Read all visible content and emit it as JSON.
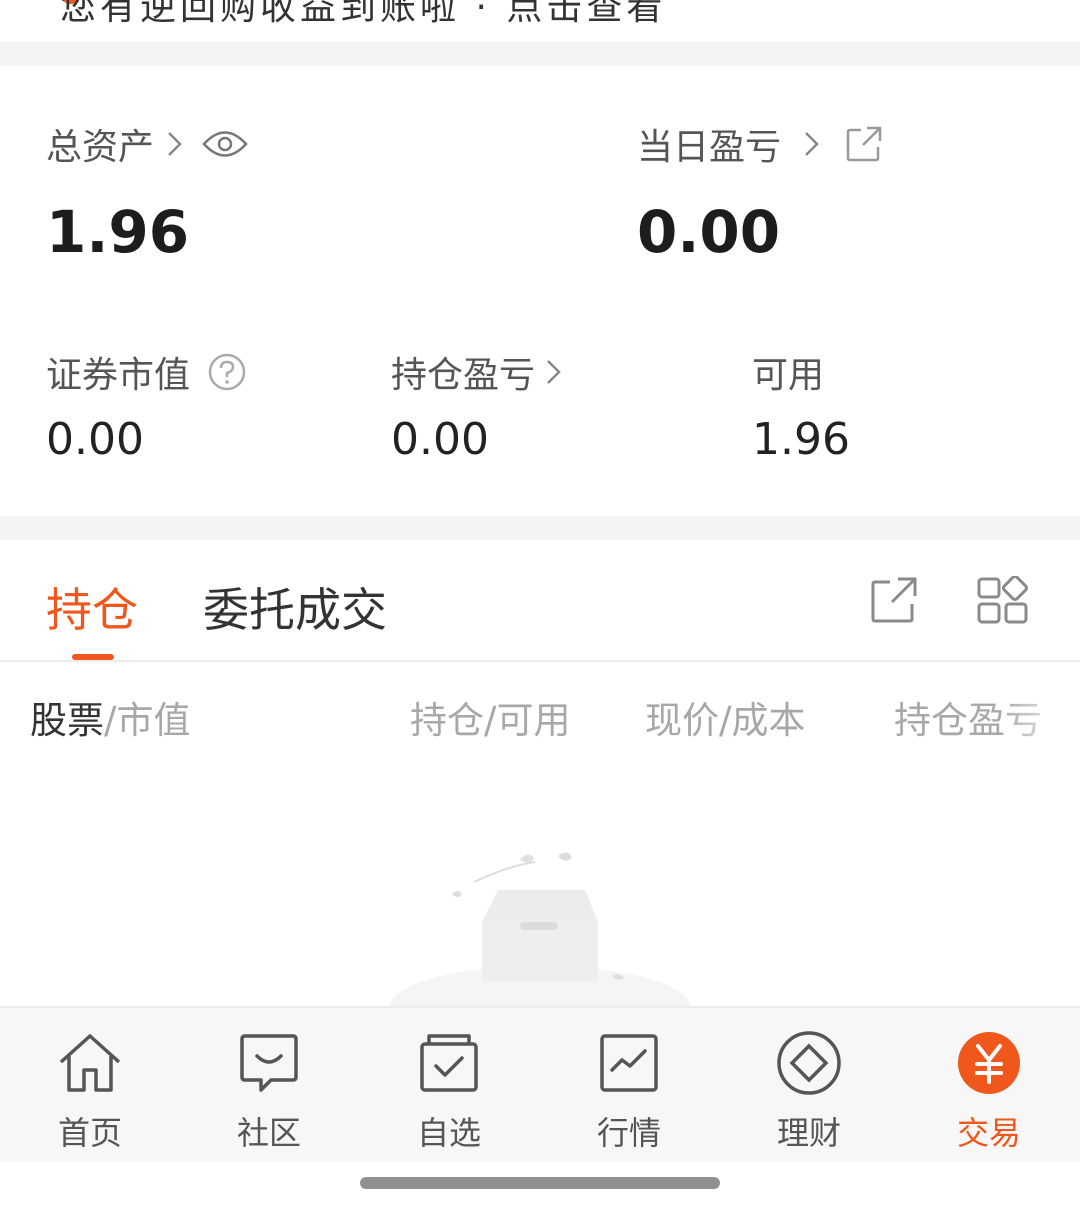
{
  "top_banner": {
    "cut_text": "您有逆回购收益到账啦 · 点击查看"
  },
  "assets": {
    "total_assets_label": "总资产",
    "total_assets_value": "1.96",
    "daily_pnl_label": "当日盈亏",
    "daily_pnl_value": "0.00",
    "market_value_label": "证券市值",
    "market_value_value": "0.00",
    "position_pnl_label": "持仓盈亏",
    "position_pnl_value": "0.00",
    "available_label": "可用",
    "available_value": "1.96"
  },
  "positions": {
    "tabs": [
      {
        "label": "持仓",
        "active": true
      },
      {
        "label": "委托成交",
        "active": false
      }
    ],
    "columns": {
      "stock_strong": "股票",
      "stock_rest": "/市值",
      "holding": "持仓/可用",
      "price": "现价/成本",
      "pnl": "持仓盈亏"
    }
  },
  "tabbar": {
    "items": [
      {
        "label": "首页",
        "icon": "home-icon"
      },
      {
        "label": "社区",
        "icon": "chat-icon"
      },
      {
        "label": "自选",
        "icon": "watchlist-icon"
      },
      {
        "label": "行情",
        "icon": "market-chart-icon"
      },
      {
        "label": "理财",
        "icon": "diamond-icon"
      },
      {
        "label": "交易",
        "icon": "yen-icon",
        "active": true
      }
    ]
  },
  "colors": {
    "accent": "#f0571c",
    "text": "#222222",
    "muted": "#a8a8a8",
    "background": "#f4f4f6"
  }
}
